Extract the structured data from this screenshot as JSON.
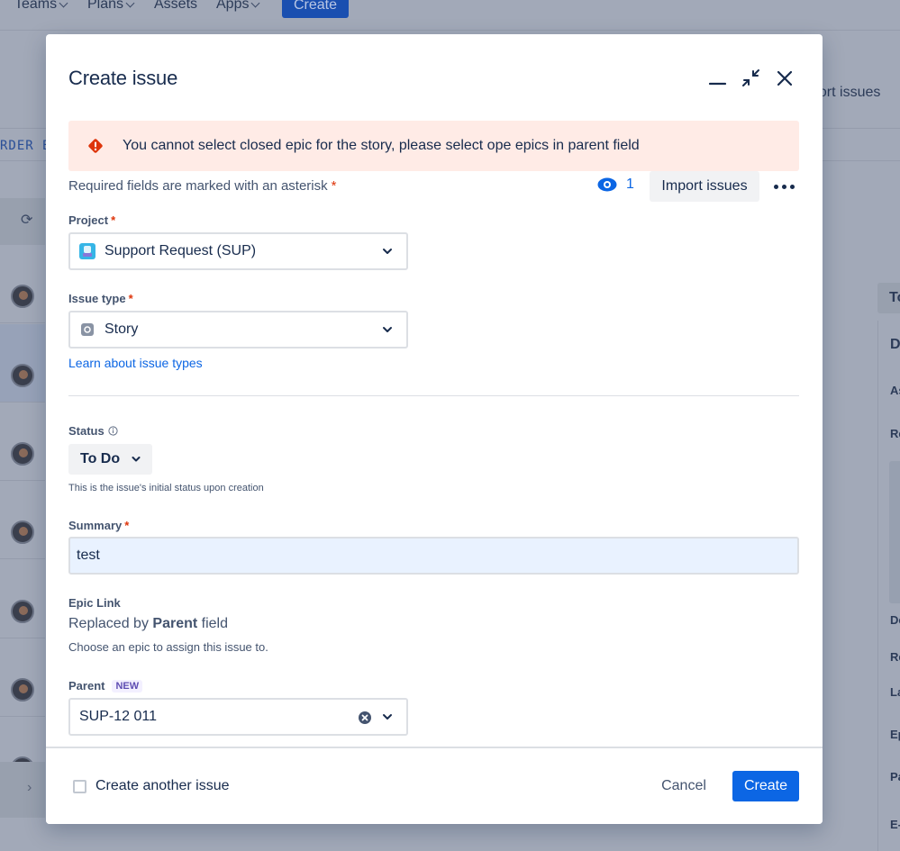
{
  "background": {
    "nav": [
      {
        "label": "Teams",
        "has_chevron": true
      },
      {
        "label": "Plans",
        "has_chevron": true
      },
      {
        "label": "Assets",
        "has_chevron": false
      },
      {
        "label": "Apps",
        "has_chevron": true
      }
    ],
    "nav_create_label": "Create",
    "import_issues_partial": "port issues",
    "board_label_partial": "RDER  B",
    "right_tab_partial": "To",
    "right_panel_partial": [
      "D",
      "As",
      "Re",
      "De",
      "Re",
      "La",
      "Ep",
      "Pa",
      "E-"
    ]
  },
  "modal": {
    "title": "Create issue",
    "minimize_label": "Minimize",
    "collapse_label": "Collapse",
    "close_label": "Close",
    "error_banner": "You cannot select closed epic for the story, please select ope epics in parent field",
    "required_note": "Required fields are marked with an asterisk",
    "asterisk": "*",
    "watch_count": "1",
    "import_issues_label": "Import issues",
    "fields": {
      "project": {
        "label": "Project",
        "value": "Support Request (SUP)",
        "icon_color": "#36b5e6"
      },
      "issue_type": {
        "label": "Issue type",
        "value": "Story",
        "icon_color": "#8993a4",
        "help_link": "Learn about issue types"
      },
      "status": {
        "label": "Status",
        "value": "To Do",
        "helper": "This is the issue's initial status upon creation"
      },
      "summary": {
        "label": "Summary",
        "value": "test"
      },
      "epic_link": {
        "label": "Epic Link",
        "replaced_prefix": "Replaced by",
        "replaced_bold": "Parent",
        "replaced_suffix": "field",
        "description": "Choose an epic to assign this issue to."
      },
      "parent": {
        "label": "Parent",
        "badge": "NEW",
        "value": "SUP-12 011"
      }
    },
    "footer": {
      "create_another_label": "Create another issue",
      "create_another_checked": false,
      "cancel_label": "Cancel",
      "create_label": "Create"
    }
  },
  "colors": {
    "primary": "#0c66e4",
    "danger": "#de350b",
    "error_bg": "#ffebe6",
    "text": "#172b4d",
    "subtle_text": "#44546f"
  }
}
